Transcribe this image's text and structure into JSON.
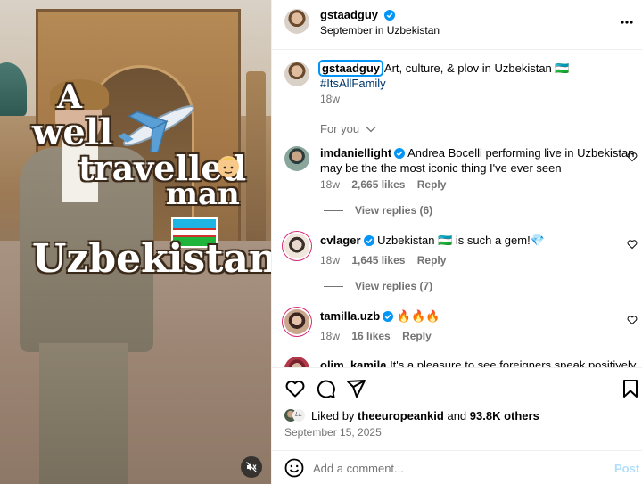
{
  "post": {
    "author": "gstaadguy",
    "location": "September in Uzbekistan",
    "media": {
      "overlay_lines": [
        "A",
        "well",
        "travelled",
        "man",
        "Uzbekistan"
      ]
    }
  },
  "caption": {
    "author": "gstaadguy",
    "text": "Art, culture, & plov in Uzbekistan 🇺🇿",
    "hashtag": "#ItsAllFamily",
    "age": "18w"
  },
  "comments_filter": "For you",
  "comments": [
    {
      "user": "imdaniellight",
      "text": "Andrea Bocelli performing live in Uzbekistan",
      "text2": "may be the the most iconic thing I've ever seen",
      "age": "18w",
      "likes": "2,665 likes",
      "reply": "Reply",
      "view_replies": "View replies (6)"
    },
    {
      "user": "cvlager",
      "text": "Uzbekistan 🇺🇿 is such a gem!💎",
      "age": "18w",
      "likes": "1,645 likes",
      "reply": "Reply",
      "view_replies": "View replies (7)"
    },
    {
      "user": "tamilla.uzb",
      "text": "🔥🔥🔥",
      "age": "18w",
      "likes": "16 likes",
      "reply": "Reply"
    },
    {
      "user": "olim_kamila",
      "text": "It's a pleasure to see foreigners speak positively"
    }
  ],
  "likes": {
    "prefix": "Liked by",
    "user": "theeuropeankid",
    "joiner": "and",
    "others": "93.8K others"
  },
  "date": "September 15, 2025",
  "add_comment": {
    "placeholder": "Add a comment...",
    "post_label": "Post"
  },
  "colors": {
    "link": "#00376b",
    "verified": "#0095f6",
    "muted": "#737373",
    "post_button": "#b2dffc"
  },
  "icons": [
    "more-icon",
    "heart-icon",
    "comment-icon",
    "share-icon",
    "bookmark-icon",
    "emoji-icon",
    "mute-icon",
    "verified-icon",
    "chevron-down-icon"
  ]
}
